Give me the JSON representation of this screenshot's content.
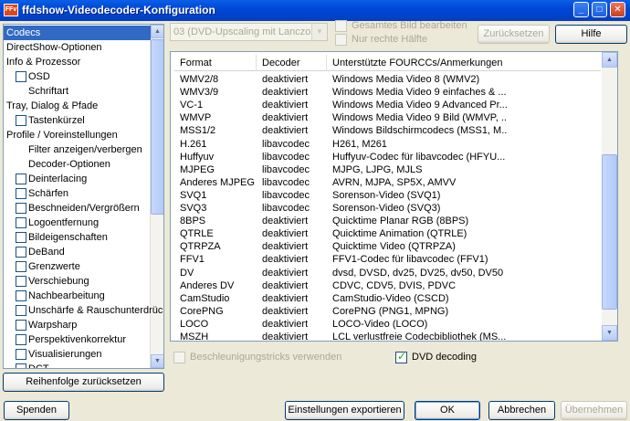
{
  "window": {
    "title": "ffdshow-Videodecoder-Konfiguration",
    "app_icon_text": "FFv",
    "minimize_glyph": "_",
    "maximize_glyph": "□",
    "close_glyph": "✕"
  },
  "tree": {
    "items": [
      {
        "label": "Codecs",
        "indent": 0,
        "checkbox": false,
        "selected": true
      },
      {
        "label": "DirectShow-Optionen",
        "indent": 0,
        "checkbox": false
      },
      {
        "label": "Info & Prozessor",
        "indent": 0,
        "checkbox": false
      },
      {
        "label": "OSD",
        "indent": 1,
        "checkbox": true
      },
      {
        "label": "Schriftart",
        "indent": 2,
        "checkbox": false
      },
      {
        "label": "Tray, Dialog & Pfade",
        "indent": 0,
        "checkbox": false
      },
      {
        "label": "Tastenkürzel",
        "indent": 1,
        "checkbox": true
      },
      {
        "label": "Profile / Voreinstellungen",
        "indent": 0,
        "checkbox": false
      },
      {
        "label": "Filter anzeigen/verbergen",
        "indent": 2,
        "checkbox": false
      },
      {
        "label": "Decoder-Optionen",
        "indent": 2,
        "checkbox": false
      },
      {
        "label": "Deinterlacing",
        "indent": 1,
        "checkbox": true
      },
      {
        "label": "Schärfen",
        "indent": 1,
        "checkbox": true
      },
      {
        "label": "Beschneiden/Vergrößern",
        "indent": 1,
        "checkbox": true
      },
      {
        "label": "Logoentfernung",
        "indent": 1,
        "checkbox": true
      },
      {
        "label": "Bildeigenschaften",
        "indent": 1,
        "checkbox": true
      },
      {
        "label": "DeBand",
        "indent": 1,
        "checkbox": true
      },
      {
        "label": "Grenzwerte",
        "indent": 1,
        "checkbox": true
      },
      {
        "label": "Verschiebung",
        "indent": 1,
        "checkbox": true
      },
      {
        "label": "Nachbearbeitung",
        "indent": 1,
        "checkbox": true
      },
      {
        "label": "Unschärfe & Rauschunterdrückung",
        "indent": 1,
        "checkbox": true
      },
      {
        "label": "Warpsharp",
        "indent": 1,
        "checkbox": true
      },
      {
        "label": "Perspektivenkorrektur",
        "indent": 1,
        "checkbox": true
      },
      {
        "label": "Visualisierungen",
        "indent": 1,
        "checkbox": true
      },
      {
        "label": "DCT",
        "indent": 1,
        "checkbox": true
      }
    ]
  },
  "reset_order_button": "Reihenfolge zurücksetzen",
  "top": {
    "preset_value": "03 (DVD-Upscaling mit Lanczos-",
    "whole_image_label": "Gesamtes Bild bearbeiten",
    "right_half_label": "Nur rechte Hälfte",
    "reset_button": "Zurücksetzen",
    "help_button": "Hilfe"
  },
  "codecs": {
    "headers": [
      "Format",
      "Decoder",
      "Unterstützte FOURCCs/Anmerkungen"
    ],
    "rows": [
      [
        "WMV2/8",
        "deaktiviert",
        "Windows Media Video 8 (WMV2)"
      ],
      [
        "WMV3/9",
        "deaktiviert",
        "Windows Media Video 9 einfaches & ..."
      ],
      [
        "VC-1",
        "deaktiviert",
        "Windows Media Video 9 Advanced Pr..."
      ],
      [
        "WMVP",
        "deaktiviert",
        "Windows Media Video 9 Bild (WMVP, ..."
      ],
      [
        "MSS1/2",
        "deaktiviert",
        "Windows Bildschirmcodecs (MSS1, M..."
      ],
      [
        "H.261",
        "libavcodec",
        "H261, M261"
      ],
      [
        "Huffyuv",
        "libavcodec",
        "Huffyuv-Codec für libavcodec (HFYU..."
      ],
      [
        "MJPEG",
        "libavcodec",
        "MJPG, LJPG, MJLS"
      ],
      [
        "Anderes MJPEG",
        "libavcodec",
        "AVRN, MJPA, SP5X, AMVV"
      ],
      [
        "SVQ1",
        "libavcodec",
        "Sorenson-Video (SVQ1)"
      ],
      [
        "SVQ3",
        "libavcodec",
        "Sorenson-Video (SVQ3)"
      ],
      [
        "8BPS",
        "deaktiviert",
        "Quicktime Planar RGB (8BPS)"
      ],
      [
        "QTRLE",
        "deaktiviert",
        "Quicktime Animation (QTRLE)"
      ],
      [
        "QTRPZA",
        "deaktiviert",
        "Quicktime Video (QTRPZA)"
      ],
      [
        "FFV1",
        "deaktiviert",
        "FFV1-Codec für libavcodec (FFV1)"
      ],
      [
        "DV",
        "deaktiviert",
        "dvsd, DVSD, dv25, DV25, dv50, DV50"
      ],
      [
        "Anderes DV",
        "deaktiviert",
        "CDVC, CDV5, DVIS, PDVC"
      ],
      [
        "CamStudio",
        "deaktiviert",
        "CamStudio-Video (CSCD)"
      ],
      [
        "CorePNG",
        "deaktiviert",
        "CorePNG (PNG1, MPNG)"
      ],
      [
        "LOCO",
        "deaktiviert",
        "LOCO-Video (LOCO)"
      ],
      [
        "MSZH",
        "deaktiviert",
        "LCL verlustfreie Codecbibliothek (MS..."
      ]
    ]
  },
  "accel_label": "Beschleunigungstricks verwenden",
  "dvd_label": "DVD decoding",
  "dvd_checked": true,
  "footer": {
    "donate": "Spenden",
    "export": "Einstellungen exportieren",
    "ok": "OK",
    "cancel": "Abbrechen",
    "apply": "Übernehmen"
  }
}
